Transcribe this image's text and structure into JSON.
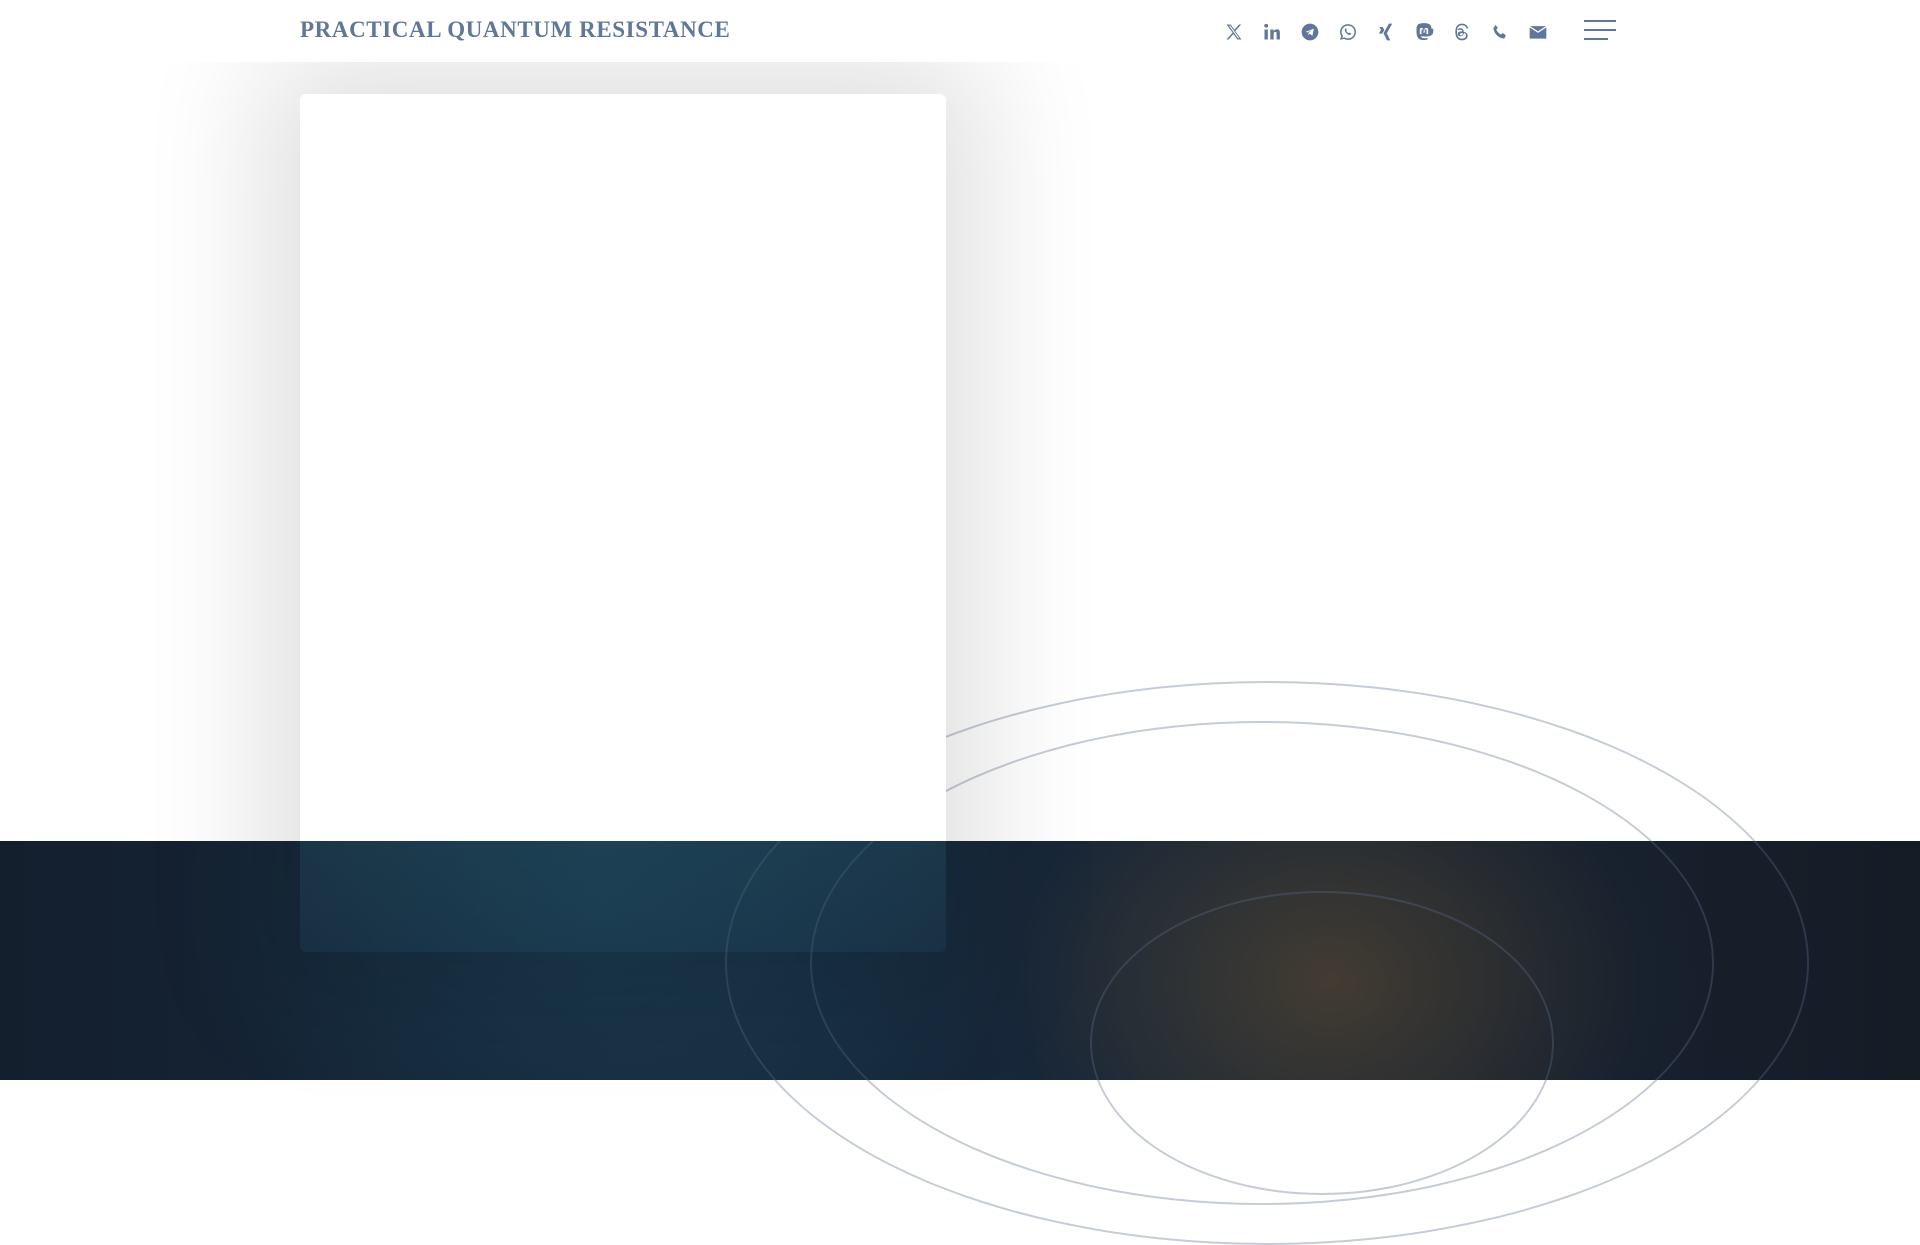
{
  "header": {
    "title": "PRACTICAL QUANTUM RESISTANCE",
    "social_icons": [
      "x-icon",
      "linkedin-icon",
      "telegram-icon",
      "whatsapp-icon",
      "xing-icon",
      "mastodon-icon",
      "threads-icon",
      "phone-icon",
      "email-icon"
    ],
    "menu_icon": "hamburger-menu-icon"
  },
  "colors": {
    "accent": "#61779a",
    "dark_band": "#141f2e"
  }
}
